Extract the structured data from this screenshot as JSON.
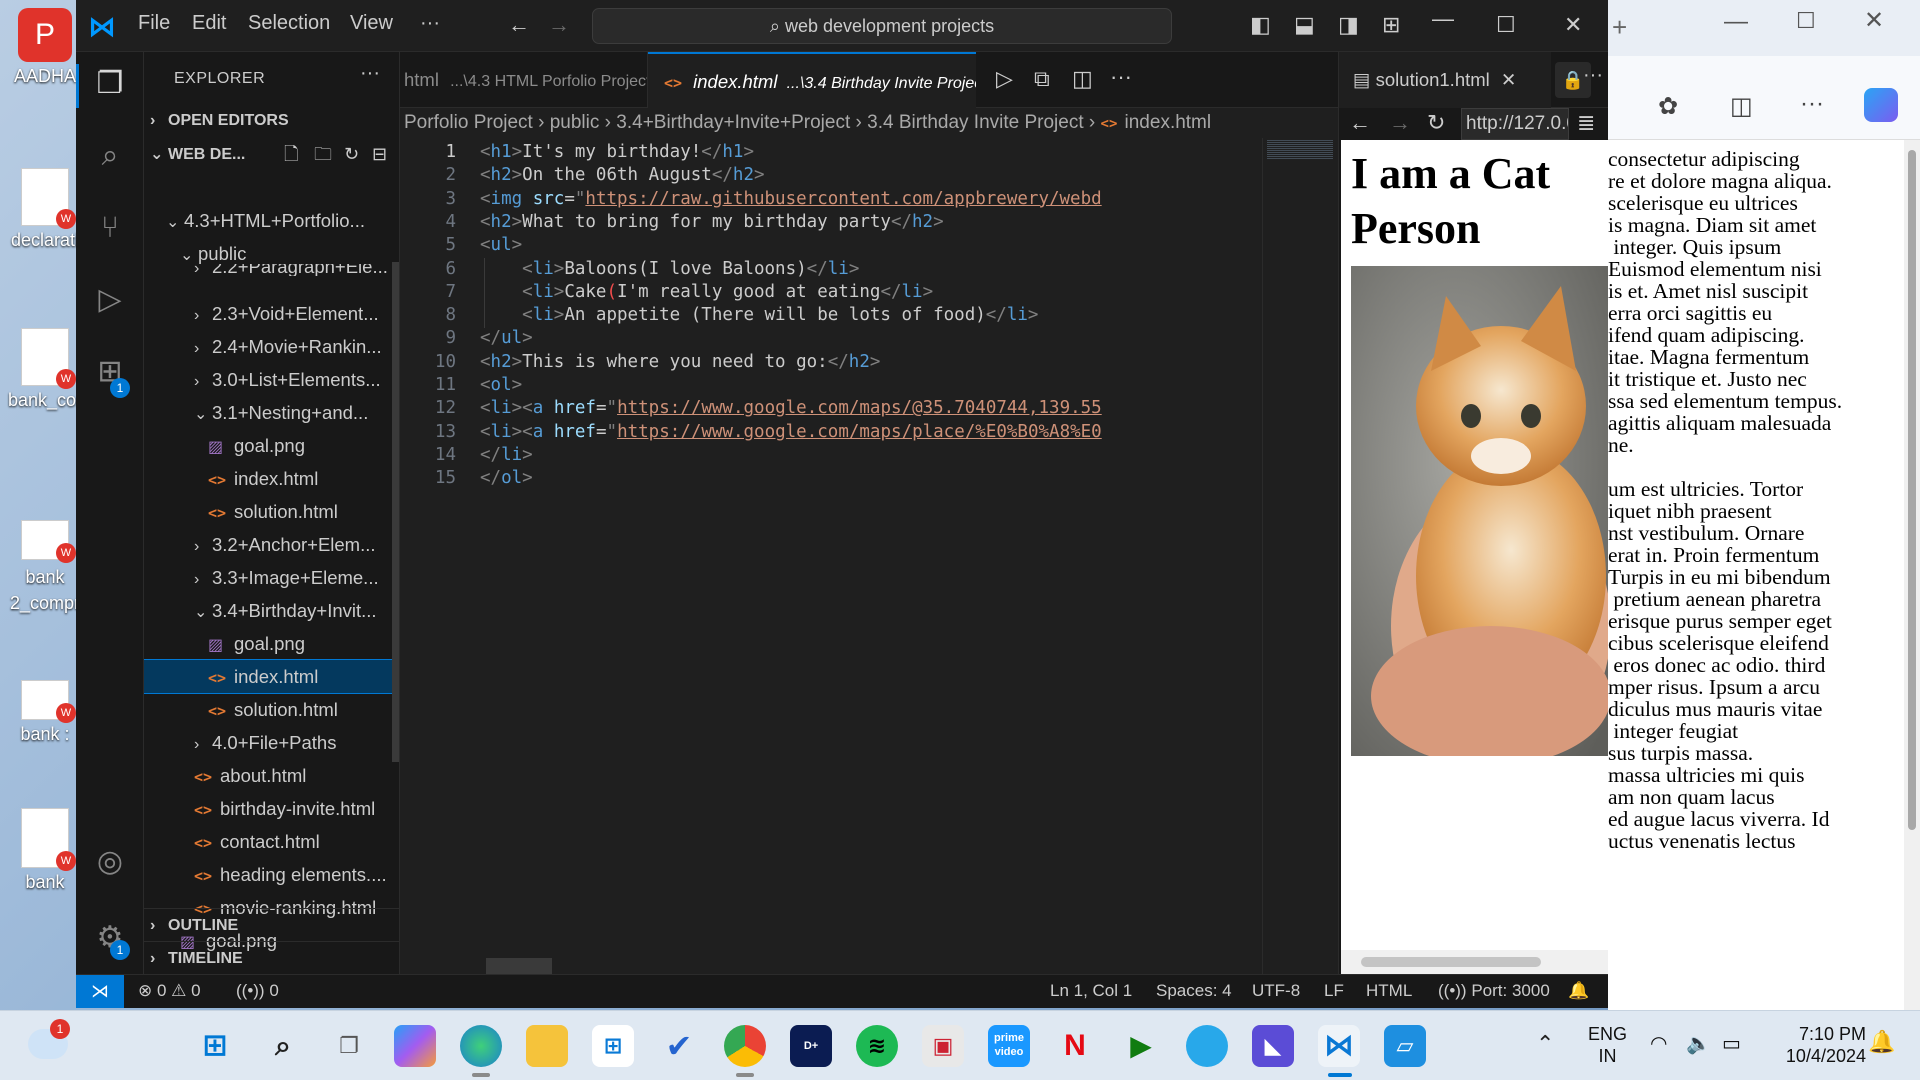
{
  "desktop": {
    "icons": [
      {
        "label": "AADHA",
        "kind": "app"
      },
      {
        "label": "declarati",
        "kind": "doc"
      },
      {
        "label": "bank_cor",
        "kind": "doc"
      },
      {
        "label": "bank",
        "label2": "2_compr",
        "kind": "doc"
      },
      {
        "label": "bank :",
        "kind": "doc"
      },
      {
        "label": "bank",
        "kind": "doc"
      }
    ]
  },
  "vscode": {
    "menu": [
      "File",
      "Edit",
      "Selection",
      "View",
      "···"
    ],
    "search_text": "web development projects",
    "explorer": {
      "title": "EXPLORER",
      "open_editors": "OPEN EDITORS",
      "workspace": "WEB DE...",
      "tree": [
        {
          "label": "4.3+HTML+Portfolio...",
          "depth": 1,
          "type": "folder",
          "open": true
        },
        {
          "label": "public",
          "depth": 2,
          "type": "folder",
          "open": true
        },
        {
          "label": "2.2+Paragraph+Ele...",
          "depth": 3,
          "type": "folder",
          "open": false,
          "partial": true
        },
        {
          "label": "2.3+Void+Element...",
          "depth": 3,
          "type": "folder",
          "open": false
        },
        {
          "label": "2.4+Movie+Rankin...",
          "depth": 3,
          "type": "folder",
          "open": false
        },
        {
          "label": "3.0+List+Elements...",
          "depth": 3,
          "type": "folder",
          "open": false
        },
        {
          "label": "3.1+Nesting+and...",
          "depth": 3,
          "type": "folder",
          "open": true
        },
        {
          "label": "goal.png",
          "depth": 4,
          "type": "png"
        },
        {
          "label": "index.html",
          "depth": 4,
          "type": "html"
        },
        {
          "label": "solution.html",
          "depth": 4,
          "type": "html"
        },
        {
          "label": "3.2+Anchor+Elem...",
          "depth": 3,
          "type": "folder",
          "open": false
        },
        {
          "label": "3.3+Image+Eleme...",
          "depth": 3,
          "type": "folder",
          "open": false
        },
        {
          "label": "3.4+Birthday+Invit...",
          "depth": 3,
          "type": "folder",
          "open": true
        },
        {
          "label": "goal.png",
          "depth": 4,
          "type": "png"
        },
        {
          "label": "index.html",
          "depth": 4,
          "type": "html",
          "selected": true
        },
        {
          "label": "solution.html",
          "depth": 4,
          "type": "html"
        },
        {
          "label": "4.0+File+Paths",
          "depth": 3,
          "type": "folder",
          "open": false
        },
        {
          "label": "about.html",
          "depth": 3,
          "type": "html"
        },
        {
          "label": "birthday-invite.html",
          "depth": 3,
          "type": "html"
        },
        {
          "label": "contact.html",
          "depth": 3,
          "type": "html"
        },
        {
          "label": "heading elements....",
          "depth": 3,
          "type": "html"
        },
        {
          "label": "movie-ranking.html",
          "depth": 3,
          "type": "html"
        },
        {
          "label": "goal.png",
          "depth": 2,
          "type": "png"
        }
      ],
      "outline": "OUTLINE",
      "timeline": "TIMELINE"
    },
    "tabs": [
      {
        "name": "html",
        "path": "...\\4.3 HTML Porfolio Project"
      },
      {
        "name": "index.html",
        "path": "...\\3.4 Birthday Invite Project"
      }
    ],
    "breadcrumbs": [
      "Porfolio Project",
      "public",
      "3.4+Birthday+Invite+Project",
      "3.4 Birthday Invite Project",
      "index.html"
    ],
    "code_lines": [
      "<h1>It's my birthday!</h1>",
      "<h2>On the 06th August</h2>",
      "<img src=\"https://raw.githubusercontent.com/appbrewery/webd",
      "<h2>What to bring for my birthday party</h2>",
      "<ul>",
      "    <li>Baloons(I love Baloons)</li>",
      "    <li>Cake(I'm really good at eating</li>",
      "    <li>An appetite (There will be lots of food)</li>",
      "</ul>",
      "<h2>This is where you need to go:</h2>",
      "<ol>",
      "<li><a href=\"https://www.google.com/maps/@35.7040744,139.55",
      "<li><a href=\"https://www.google.com/maps/place/%E0%B0%A8%E0",
      "</li>",
      "</ol>"
    ],
    "browser_tab": "solution1.html",
    "browser_url": "http://127.0.0.",
    "preview_heading": "I am a Cat Person",
    "status": {
      "errors": "0",
      "warnings": "0",
      "ports_count": "0",
      "position": "Ln 1, Col 1",
      "spaces": "Spaces: 4",
      "encoding": "UTF-8",
      "eol": "LF",
      "language": "HTML",
      "port": "Port: 3000"
    }
  },
  "edge_text": [
    "consectetur adipiscing",
    "re et dolore magna aliqua.",
    "scelerisque eu ultrices",
    "is magna. Diam sit amet",
    " integer. Quis ipsum",
    "Euismod elementum nisi",
    "is et. Amet nisl suscipit",
    "erra orci sagittis eu",
    "ifend quam adipiscing.",
    "itae. Magna fermentum",
    "it tristique et. Justo nec",
    "ssa sed elementum tempus.",
    "agittis aliquam malesuada",
    "ne.",
    "",
    "um est ultricies. Tortor",
    "iquet nibh praesent",
    "nst vestibulum. Ornare",
    "erat in. Proin fermentum",
    "Turpis in eu mi bibendum",
    " pretium aenean pharetra",
    "erisque purus semper eget",
    "cibus scelerisque eleifend",
    " eros donec ac odio. third",
    "mper risus. Ipsum a arcu",
    "diculus mus mauris vitae",
    " integer feugiat",
    "sus turpis massa.",
    "massa ultricies mi quis",
    "am non quam lacus",
    "ed augue lacus viverra. Id",
    "uctus venenatis lectus"
  ],
  "taskbar": {
    "lang_top": "ENG",
    "lang_bottom": "IN",
    "time": "7:10 PM",
    "date": "10/4/2024",
    "weather_badge": "1"
  },
  "colors": {
    "vscode_bg": "#1e1e1e",
    "status_accent": "#0078d4",
    "selection": "#04395e"
  }
}
